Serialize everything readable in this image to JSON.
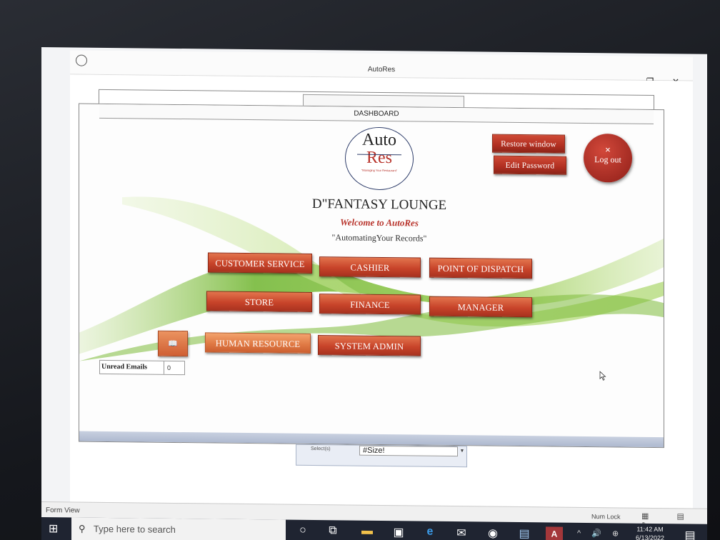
{
  "window": {
    "title": "AutoRes",
    "minimize_glyph": "—",
    "restore_glyph": "❐",
    "close_glyph": "✕"
  },
  "dashboard": {
    "header": "DASHBOARD",
    "logo": {
      "line1": "Auto",
      "line2": "Res",
      "tagline": "\"Managing Your Restaurant\""
    },
    "company_name": "D\"FANTASY LOUNGE",
    "welcome": "Welcome to AutoRes",
    "motto": "\"AutomatingYour Records\"",
    "restore_window": "Restore window",
    "edit_password": "Edit Password",
    "logout": {
      "x_glyph": "✕",
      "label": "Log out"
    },
    "menu": {
      "customer_service": "CUSTOMER SERVICE",
      "cashier": "CASHIER",
      "point_of_dispatch": "POINT OF DISPATCH",
      "store": "STORE",
      "finance": "FINANCE",
      "manager": "MANAGER",
      "human_resource": "HUMAN RESOURCE",
      "system_admin": "SYSTEM ADMIN"
    },
    "book_icon_glyph": "📖",
    "unread_emails": {
      "label": "Unread Emails",
      "value": "0"
    }
  },
  "underlying_form": {
    "field_label": "Select(s)",
    "field_value": "#Size!",
    "dropdown_glyph": "▼"
  },
  "statusbar": {
    "view": "Form View",
    "num_lock": "Num Lock",
    "view_icons": "▦ ▤ ✎"
  },
  "taskbar": {
    "start_glyph": "⊞",
    "search_placeholder": "Type here to search",
    "search_glyph": "⚲",
    "cortana_glyph": "○",
    "taskview_glyph": "⧉",
    "explorer_glyph": "▬",
    "store_glyph": "▣",
    "edge_glyph": "e",
    "mail_glyph": "✉",
    "chrome_glyph": "◉",
    "app_glyph": "▤",
    "access_glyph": "A",
    "tray": "^ 🔊 ⊕",
    "time": "11:42 AM",
    "date": "6/13/2022",
    "notif_glyph": "▤"
  }
}
